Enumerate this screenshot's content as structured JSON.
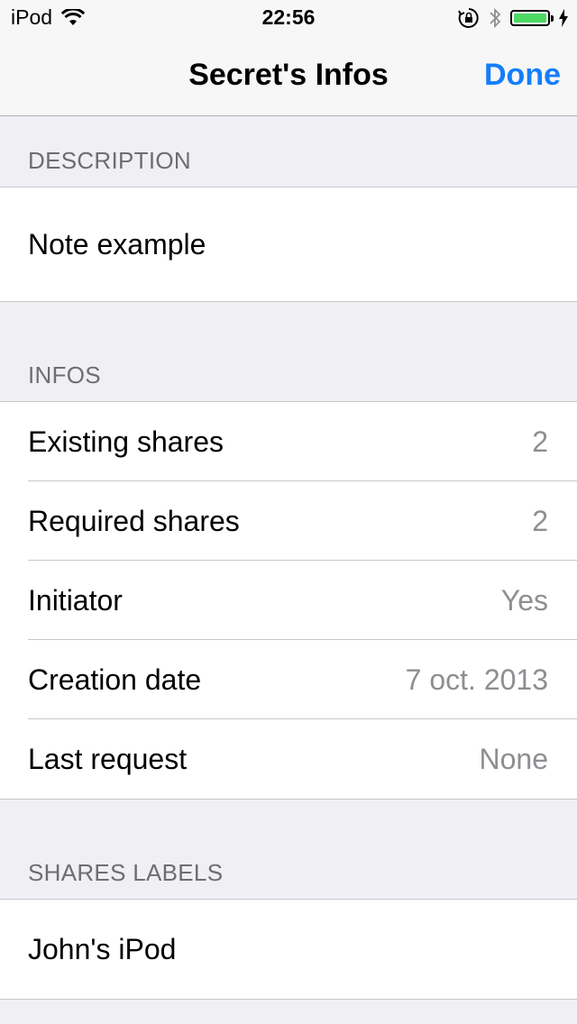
{
  "status_bar": {
    "carrier": "iPod",
    "time": "22:56",
    "icons": [
      "wifi-icon",
      "orientation-lock-icon",
      "bluetooth-icon",
      "battery-icon",
      "charging-bolt-icon"
    ],
    "battery_color": "#4cd964"
  },
  "nav": {
    "title": "Secret's Infos",
    "done_label": "Done",
    "accent_color": "#157efb"
  },
  "sections": {
    "description": {
      "header": "DESCRIPTION",
      "text": "Note example"
    },
    "infos": {
      "header": "INFOS",
      "rows": [
        {
          "label": "Existing shares",
          "value": "2"
        },
        {
          "label": "Required shares",
          "value": "2"
        },
        {
          "label": "Initiator",
          "value": "Yes"
        },
        {
          "label": "Creation date",
          "value": "7 oct. 2013"
        },
        {
          "label": "Last request",
          "value": "None"
        }
      ]
    },
    "shares_labels": {
      "header": "SHARES LABELS",
      "items": [
        "John's iPod"
      ]
    }
  }
}
